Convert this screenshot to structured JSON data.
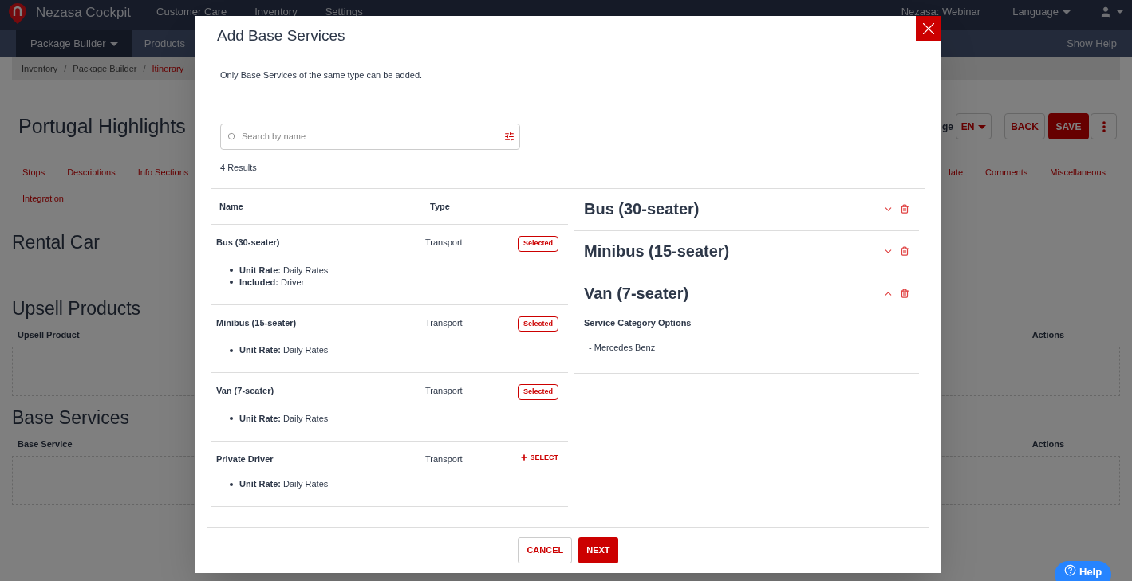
{
  "nav": {
    "brand": "Nezasa Cockpit",
    "links": [
      "Customer Care",
      "Inventory",
      "Settings"
    ],
    "account": "Nezasa: Webinar",
    "language": "Language"
  },
  "subnav": {
    "items": [
      {
        "label": "Package Builder",
        "selected": true,
        "dropdown": true
      },
      {
        "label": "Products",
        "selected": false,
        "dropdown": false
      }
    ],
    "help": "Show Help"
  },
  "breadcrumb_separator": "/",
  "breadcrumb": [
    {
      "label": "Inventory",
      "current": false
    },
    {
      "label": "Package Builder",
      "current": false
    },
    {
      "label": "Itinerary",
      "current": true
    }
  ],
  "page": {
    "title": "Portugal Highlights",
    "language_label": "ge",
    "language": "EN",
    "back": "BACK",
    "save": "SAVE"
  },
  "tab_rows": [
    {
      "start": [
        "Stops",
        "Descriptions",
        "Info Sections"
      ],
      "end": [
        "late",
        "Comments",
        "Miscellaneous"
      ]
    },
    {
      "start": [
        "Integration"
      ],
      "end": []
    }
  ],
  "sections": [
    {
      "kind": "heading",
      "title": "Rental Car"
    },
    {
      "kind": "table",
      "title": "Upsell Products",
      "columns": [
        "Upsell Product",
        "Actions"
      ]
    },
    {
      "kind": "table",
      "title": "Base Services",
      "columns": [
        "Base Service",
        "Actions"
      ]
    }
  ],
  "help_button": "Help",
  "modal": {
    "title": "Add Base Services",
    "note": "Only Base Services of the same type can be added.",
    "search": {
      "placeholder": "Search by name"
    },
    "results_count": "4 Results",
    "columns": [
      "Name",
      "Type"
    ],
    "results": [
      {
        "name": "Bus (30-seater)",
        "type": "Transport",
        "selected": true,
        "action": "Selected",
        "details": [
          {
            "label": "Unit Rate:",
            "value": "Daily Rates"
          },
          {
            "label": "Included:",
            "value": "Driver"
          }
        ]
      },
      {
        "name": "Minibus (15-seater)",
        "type": "Transport",
        "selected": true,
        "action": "Selected",
        "details": [
          {
            "label": "Unit Rate:",
            "value": "Daily Rates"
          }
        ]
      },
      {
        "name": "Van (7-seater)",
        "type": "Transport",
        "selected": true,
        "action": "Selected",
        "details": [
          {
            "label": "Unit Rate:",
            "value": "Daily Rates"
          }
        ]
      },
      {
        "name": "Private Driver",
        "type": "Transport",
        "selected": false,
        "action": "SELECT",
        "details": [
          {
            "label": "Unit Rate:",
            "value": "Daily Rates"
          }
        ]
      }
    ],
    "chosen": [
      {
        "title": "Bus (30-seater)",
        "expanded": false
      },
      {
        "title": "Minibus (15-seater)",
        "expanded": false
      },
      {
        "title": "Van (7-seater)",
        "expanded": true,
        "heading": "Service Category Options",
        "options": [
          "- Mercedes Benz"
        ]
      }
    ],
    "cancel": "CANCEL",
    "next": "NEXT"
  }
}
